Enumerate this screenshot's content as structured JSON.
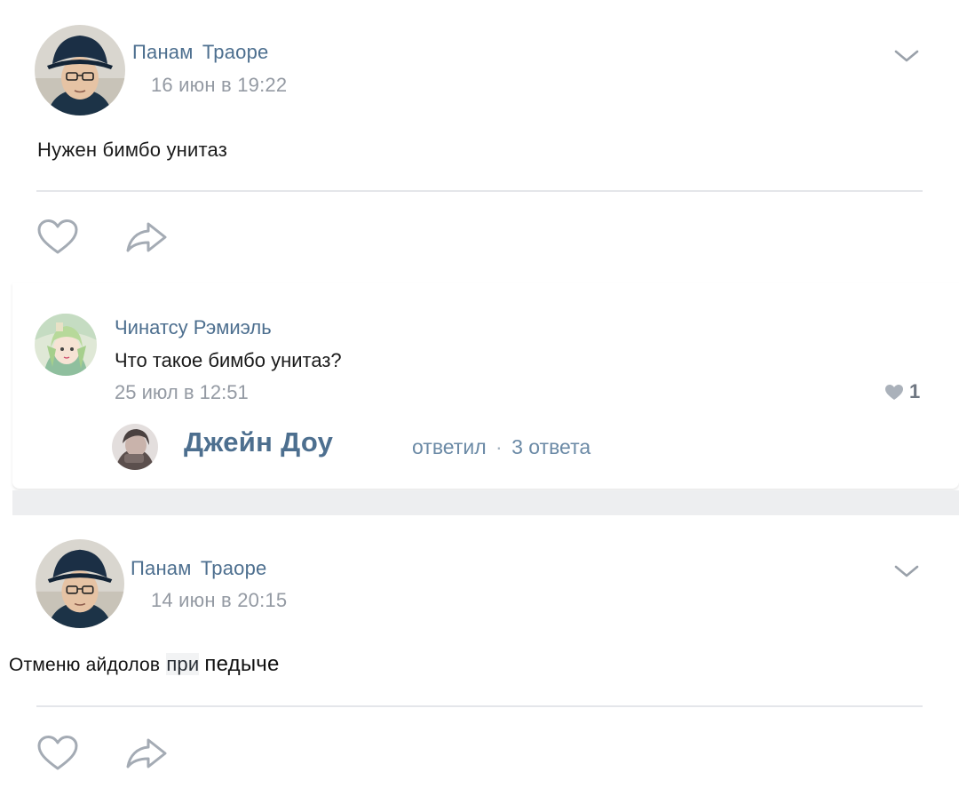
{
  "posts": [
    {
      "author_first": "Панам",
      "author_last": "Траоре",
      "date": "16 июн в 19:22",
      "text": "Нужен бимбо унитаз"
    },
    {
      "author_first": "Панам",
      "author_last": "Траоре",
      "date": "14 июн в 20:15",
      "text_part1": "Отменю айдолов",
      "text_part2": "при",
      "text_part3": "педыче"
    }
  ],
  "comment": {
    "author": "Чинатсу Рэмиэль",
    "text": "Что такое бимбо унитаз?",
    "date": "25 июл в 12:51",
    "like_count": "1",
    "reply": {
      "name": "Джейн Доу",
      "action": "ответил",
      "separator": "·",
      "count": "3 ответа"
    }
  },
  "icons": [
    "chevron-down-icon",
    "heart-icon",
    "share-arrow-icon"
  ],
  "colors": {
    "author_link": "#4d6f8f",
    "meta_gray": "#949aa3",
    "divider": "#e4e6ea",
    "page_gap": "#edeef0"
  }
}
